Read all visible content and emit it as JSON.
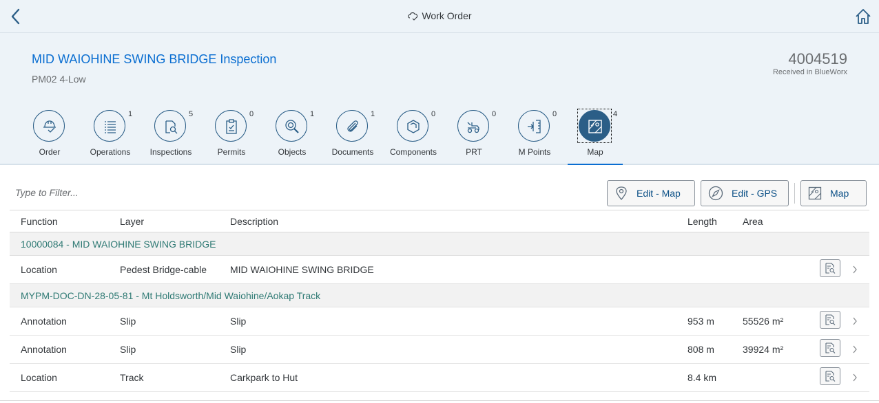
{
  "shell": {
    "title": "Work Order",
    "icons": {
      "back": "back-arrow-icon",
      "home": "home-icon",
      "title": "cloud-check-icon"
    }
  },
  "header": {
    "title": "MID WAIOHINE SWING BRIDGE Inspection",
    "subtitle": "PM02 4-Low",
    "number": "4004519",
    "status": "Received in BlueWorx"
  },
  "tabs": [
    {
      "label": "Order",
      "count": "",
      "icon": "hardhat-check-icon"
    },
    {
      "label": "Operations",
      "count": "1",
      "icon": "list-icon"
    },
    {
      "label": "Inspections",
      "count": "5",
      "icon": "document-search-icon"
    },
    {
      "label": "Permits",
      "count": "0",
      "icon": "clipboard-check-icon"
    },
    {
      "label": "Objects",
      "count": "1",
      "icon": "object-search-icon"
    },
    {
      "label": "Documents",
      "count": "1",
      "icon": "paperclip-icon"
    },
    {
      "label": "Components",
      "count": "0",
      "icon": "cube-icon"
    },
    {
      "label": "PRT",
      "count": "0",
      "icon": "tractor-icon"
    },
    {
      "label": "M Points",
      "count": "0",
      "icon": "measuring-point-icon"
    },
    {
      "label": "Map",
      "count": "4",
      "icon": "map-icon",
      "active": true
    }
  ],
  "toolbar": {
    "filter_placeholder": "Type to Filter...",
    "edit_map": "Edit - Map",
    "edit_gps": "Edit - GPS",
    "map": "Map"
  },
  "table": {
    "columns": [
      "Function",
      "Layer",
      "Description",
      "Length",
      "Area"
    ],
    "groups": [
      {
        "title": "10000084 - MID WAIOHINE SWING BRIDGE",
        "rows": [
          {
            "function": "Location",
            "layer": "Pedest Bridge-cable",
            "description": "MID WAIOHINE SWING BRIDGE",
            "length": "",
            "area": ""
          }
        ]
      },
      {
        "title": "MYPM-DOC-DN-28-05-81 - Mt Holdsworth/Mid Waiohine/Aokap Track",
        "rows": [
          {
            "function": "Annotation",
            "layer": "Slip",
            "description": "Slip",
            "length": "953 m",
            "area": "55526 m²"
          },
          {
            "function": "Annotation",
            "layer": "Slip",
            "description": "Slip",
            "length": "808 m",
            "area": "39924 m²"
          },
          {
            "function": "Location",
            "layer": "Track",
            "description": "Carkpark to Hut",
            "length": "8.4 km",
            "area": ""
          }
        ]
      }
    ]
  }
}
